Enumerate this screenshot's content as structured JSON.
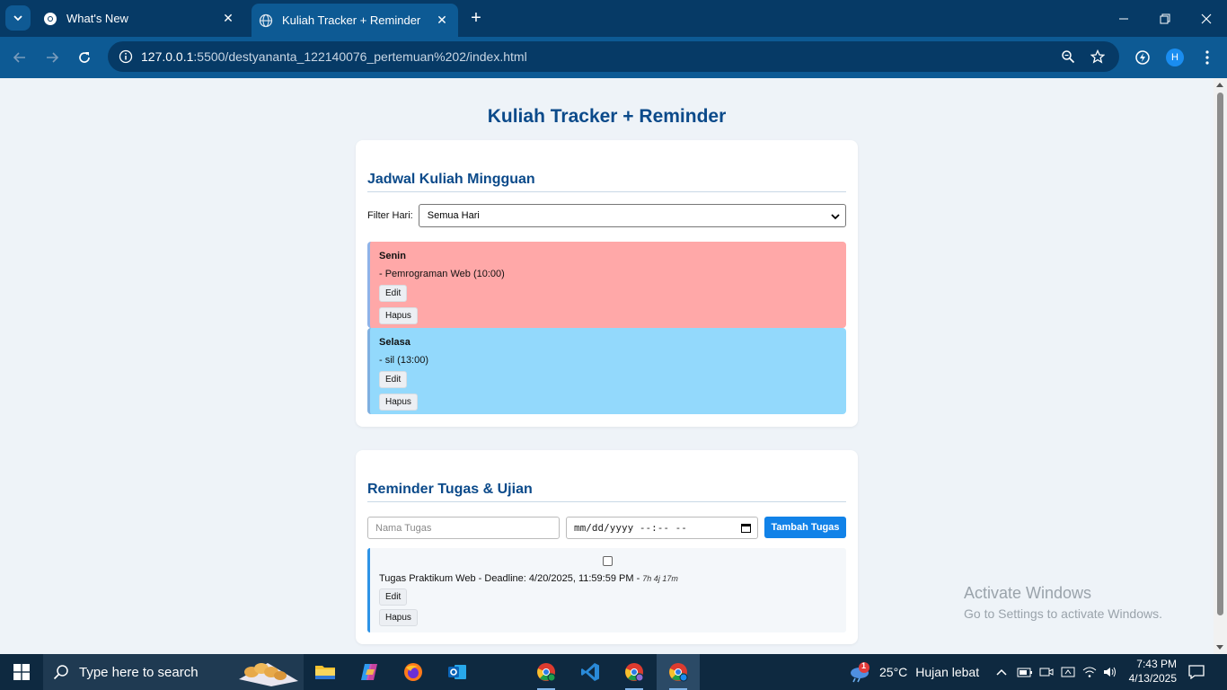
{
  "browser": {
    "tabs": [
      {
        "title": "What's New",
        "active": false
      },
      {
        "title": "Kuliah Tracker + Reminder",
        "active": true
      }
    ],
    "url_host": "127.0.0.1",
    "url_path": ":5500/destyananta_122140076_pertemuan%202/index.html",
    "profile_initial": "H"
  },
  "page": {
    "title": "Kuliah Tracker + Reminder",
    "schedule": {
      "heading": "Jadwal Kuliah Mingguan",
      "filter_label": "Filter Hari:",
      "filter_value": "Semua Hari",
      "days": [
        {
          "name": "Senin",
          "item": "- Pemrograman Web (10:00)",
          "edit": "Edit",
          "delete": "Hapus",
          "color": "#ffa8a8"
        },
        {
          "name": "Selasa",
          "item": "- sil (13:00)",
          "edit": "Edit",
          "delete": "Hapus",
          "color": "#93d9fc"
        }
      ]
    },
    "reminder": {
      "heading": "Reminder Tugas & Ujian",
      "name_placeholder": "Nama Tugas",
      "date_placeholder": "mm/dd/yyyy --:-- --",
      "add_button": "Tambah Tugas",
      "tasks": [
        {
          "text": "Tugas Praktikum Web - Deadline: 4/20/2025, 11:59:59 PM - ",
          "remaining": "7h 4j 17m",
          "checked": false,
          "edit": "Edit",
          "delete": "Hapus"
        }
      ]
    }
  },
  "watermark": {
    "line1": "Activate Windows",
    "line2": "Go to Settings to activate Windows."
  },
  "taskbar": {
    "search_placeholder": "Type here to search",
    "weather_temp": "25°C",
    "weather_desc": "Hujan lebat",
    "weather_badge": "1",
    "time": "7:43 PM",
    "date": "4/13/2025"
  },
  "colors": {
    "accent": "#1182e8",
    "heading": "#0b4a8a",
    "chrome_dark": "#063a66",
    "chrome_light": "#0d5a94"
  }
}
